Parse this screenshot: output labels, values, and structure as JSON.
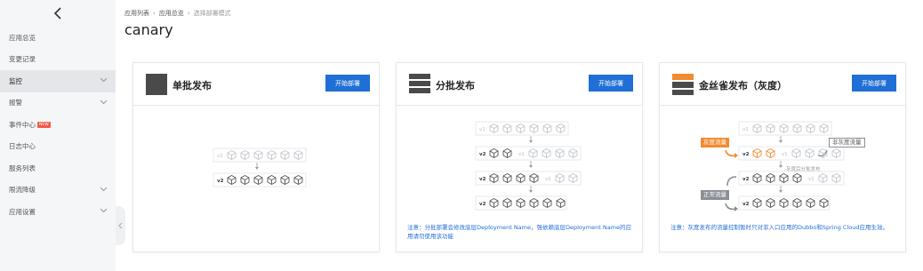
{
  "sidebar": {
    "items": [
      {
        "label": "应用总览",
        "has_chevron": false
      },
      {
        "label": "变更记录",
        "has_chevron": false
      },
      {
        "label": "监控",
        "has_chevron": true,
        "active": true
      },
      {
        "label": "报警",
        "has_chevron": true
      },
      {
        "label": "事件中心",
        "badge": "NEW",
        "has_chevron": false
      },
      {
        "label": "日志中心",
        "has_chevron": false
      },
      {
        "label": "服务列表",
        "has_chevron": false
      },
      {
        "label": "限流降级",
        "has_chevron": true
      },
      {
        "label": "应用设置",
        "has_chevron": true
      }
    ]
  },
  "breadcrumb": {
    "items": [
      "应用列表",
      "应用总览",
      "选择部署模式"
    ]
  },
  "page": {
    "title": "canary"
  },
  "cards": {
    "single": {
      "title": "单批发布",
      "button": "开始部署",
      "v1": "v1",
      "v2": "v2"
    },
    "batch": {
      "title": "分批发布",
      "button": "开始部署",
      "v1": "v1",
      "v2": "v2",
      "note": "注意：分批部署会修改底层Deployment Name，强依赖底层Deployment Name的应用请勿使用该功能"
    },
    "canary": {
      "title": "金丝雀发布（灰度）",
      "button": "开始部署",
      "v1": "v1",
      "v2": "v2",
      "tag_gray_traffic": "灰度流量",
      "tag_non_gray_traffic": "非灰度流量",
      "tag_normal_traffic": "正常流量",
      "gray_batch_note": "灰度后分批发布",
      "note": "注意：灰度发布的流量控制暂时只对非入口应用的Dubbo和Spring Cloud应用生效。"
    }
  },
  "colors": {
    "accent": "#1f6fd6",
    "canary_orange": "#f28a30",
    "sidebar_bg": "#f5f6f7",
    "badge_red": "#f05a4a"
  }
}
